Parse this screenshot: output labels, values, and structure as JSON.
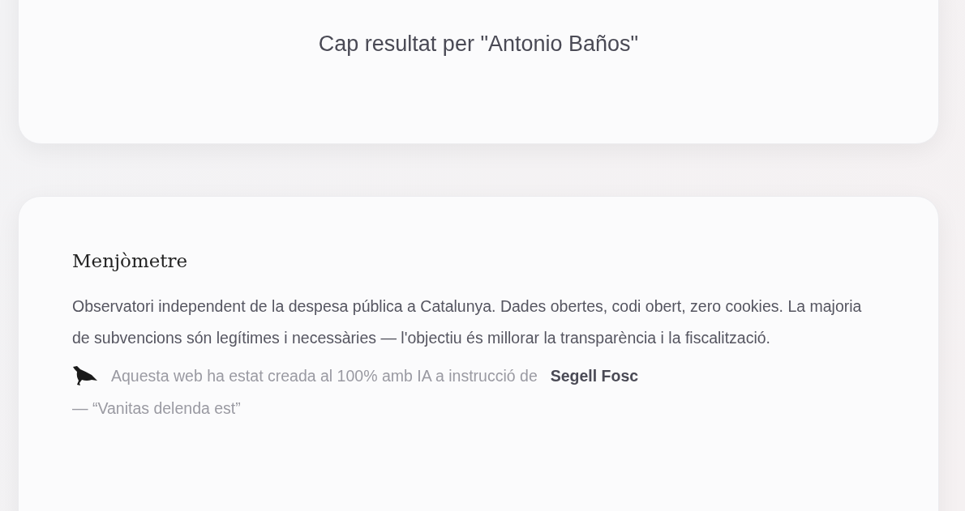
{
  "search_result": {
    "message": "Cap resultat per \"Antonio Baños\""
  },
  "footer": {
    "title": "Menjòmetre",
    "description": "Observatori independent de la despesa pública a Catalunya. Dades obertes, codi obert, zero cookies. La majoria de subvencions són legítimes i necessàries — l'objectiu és millorar la transparència i la fiscalització.",
    "credit": "Aquesta web ha estat creada al 100% amb IA a instrucció de",
    "credit_link": "Segell Fosc",
    "motto": "— “Vanitas delenda est”"
  }
}
